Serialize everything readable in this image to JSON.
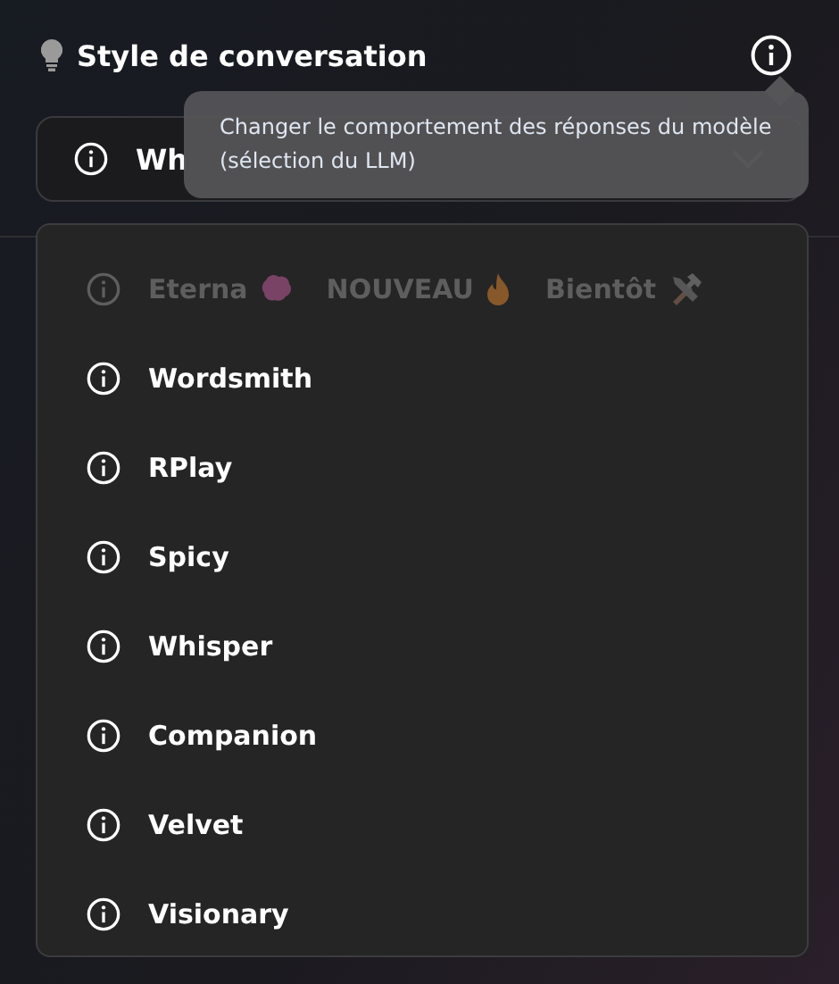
{
  "header": {
    "title": "Style de conversation"
  },
  "select": {
    "value": "Wh"
  },
  "tooltip": {
    "text": "Changer le comportement des réponses du modèle (sélection du LLM)"
  },
  "options": [
    {
      "label": "Eterna",
      "badge": "NOUVEAU",
      "note": "Bientôt",
      "disabled": true
    },
    {
      "label": "Wordsmith",
      "disabled": false
    },
    {
      "label": "RPlay",
      "disabled": false
    },
    {
      "label": "Spicy",
      "disabled": false
    },
    {
      "label": "Whisper",
      "disabled": false
    },
    {
      "label": "Companion",
      "disabled": false
    },
    {
      "label": "Velvet",
      "disabled": false
    },
    {
      "label": "Visionary",
      "disabled": false
    }
  ]
}
